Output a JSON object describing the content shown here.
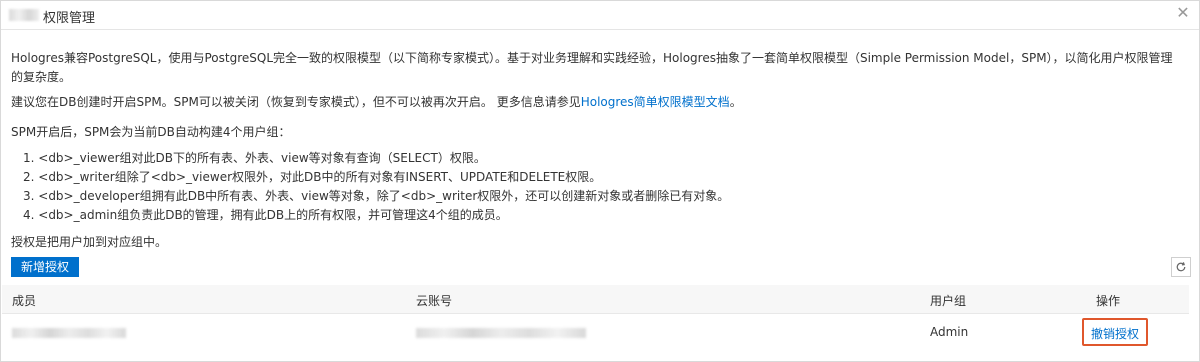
{
  "dialog": {
    "title": "权限管理",
    "close_icon": "close-icon"
  },
  "intro": {
    "p1": "Hologres兼容PostgreSQL，使用与PostgreSQL完全一致的权限模型（以下简称专家模式）。基于对业务理解和实践经验，Hologres抽象了一套简单权限模型（Simple Permission Model，SPM），以简化用户权限管理的复杂度。",
    "p2_text": "建议您在DB创建时开启SPM。SPM可以被关闭（恢复到专家模式），但不可以被再次开启。 更多信息请参见",
    "p2_link": "Hologres简单权限模型文档",
    "p2_end": "。",
    "p3": "SPM开启后，SPM会为当前DB自动构建4个用户组：",
    "list": [
      "1. <db>_viewer组对此DB下的所有表、外表、view等对象有查询（SELECT）权限。",
      "2. <db>_writer组除了<db>_viewer权限外，对此DB中的所有对象有INSERT、UPDATE和DELETE权限。",
      "3. <db>_developer组拥有此DB中所有表、外表、view等对象，除了<db>_writer权限外，还可以创建新对象或者删除已有对象。",
      "4. <db>_admin组负责此DB的管理，拥有此DB上的所有权限，并可管理这4个组的成员。"
    ],
    "p4": "授权是把用户加到对应组中。"
  },
  "toolbar": {
    "add_label": "新增授权",
    "refresh_icon": "refresh-icon"
  },
  "table": {
    "columns": [
      "成员",
      "云账号",
      "用户组",
      "操作"
    ],
    "rows": [
      {
        "group": "Admin",
        "action": "撤销授权"
      }
    ]
  },
  "colors": {
    "primary": "#0070cc",
    "highlight_border": "#e0572c"
  }
}
